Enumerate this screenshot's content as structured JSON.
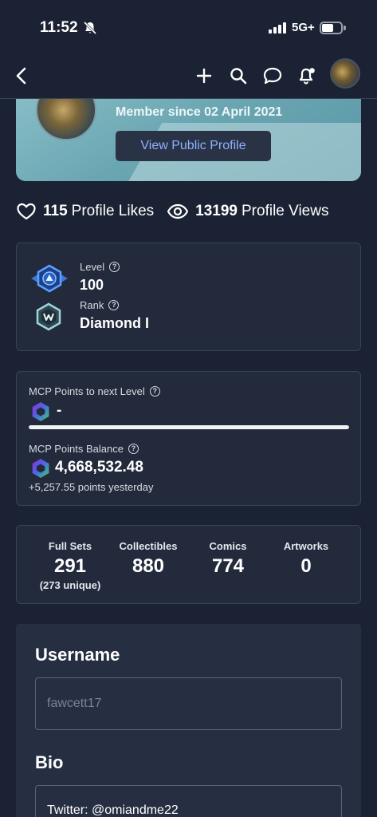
{
  "status_bar": {
    "time": "11:52",
    "network": "5G+",
    "battery_level": 0.62
  },
  "nav": {
    "icons": [
      "back-arrow-icon",
      "plus-icon",
      "search-icon",
      "chat-bubble-icon",
      "notification-bell-icon",
      "user-avatar"
    ]
  },
  "profile": {
    "member_since": "Member since 02 April 2021",
    "view_profile_label": "View Public Profile"
  },
  "stats": {
    "likes_count": "115",
    "likes_label": "Profile Likes",
    "views_count": "13199",
    "views_label": "Profile Views"
  },
  "level_card": {
    "level_label": "Level",
    "level_value": "100",
    "rank_label": "Rank",
    "rank_value": "Diamond I"
  },
  "mcp": {
    "next_label": "MCP Points to next Level",
    "next_value": "-",
    "progress": 1.0,
    "balance_label": "MCP Points Balance",
    "balance_value": "4,668,532.48",
    "yesterday": "+5,257.55 points yesterday"
  },
  "counts": [
    {
      "label": "Full Sets",
      "value": "291",
      "sub": "(273 unique)"
    },
    {
      "label": "Collectibles",
      "value": "880",
      "sub": ""
    },
    {
      "label": "Comics",
      "value": "774",
      "sub": ""
    },
    {
      "label": "Artworks",
      "value": "0",
      "sub": ""
    }
  ],
  "form": {
    "username_heading": "Username",
    "username_placeholder": "fawcett17",
    "bio_heading": "Bio",
    "bio_value": "Twitter: @omiandme22"
  },
  "colors": {
    "background": "#1b2233",
    "card": "#222a3b",
    "accent_link": "#8fb1ff",
    "hero_teal": "#6aa6b2"
  }
}
